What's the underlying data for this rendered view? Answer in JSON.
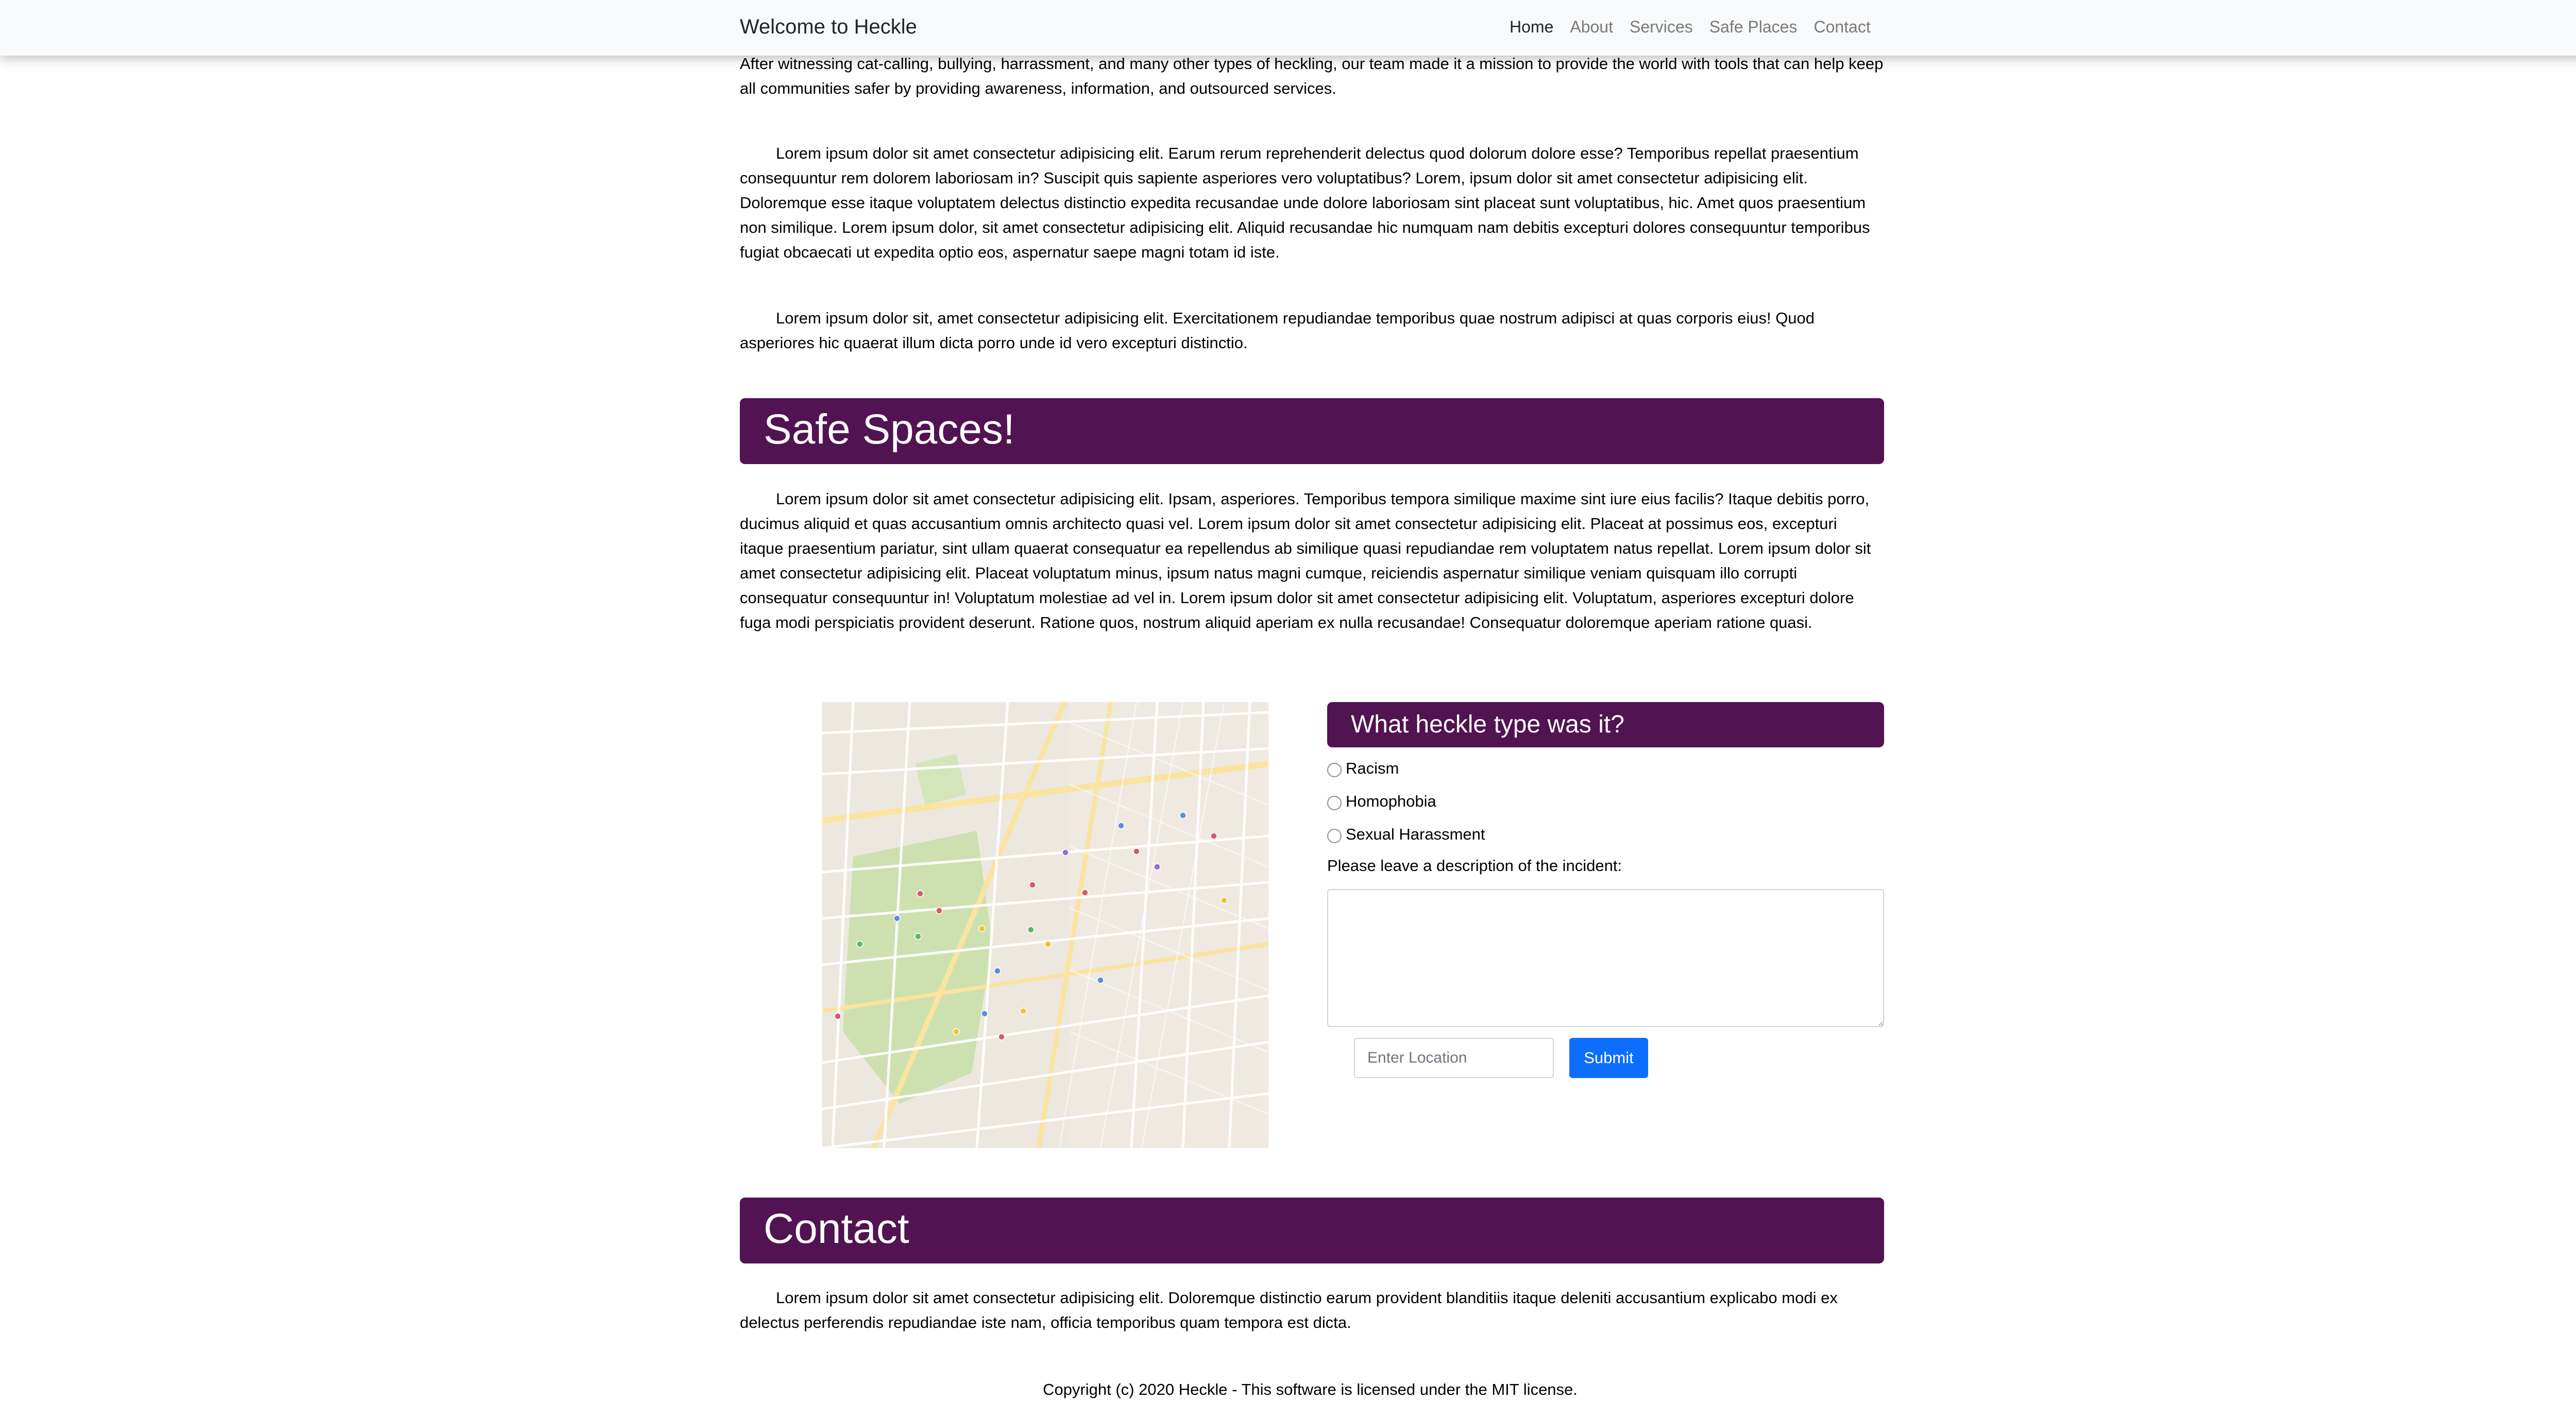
{
  "navbar": {
    "brand": "Welcome to Heckle",
    "links": [
      "Home",
      "About",
      "Services",
      "Safe Places",
      "Contact"
    ],
    "active_link": "Home"
  },
  "intro": {
    "p1": "After witnessing cat-calling, bullying, harrassment, and many other types of heckling, our team made it a mission to provide the world with tools that can help keep all communities safer by providing awareness, information, and outsourced services.",
    "p2": "Lorem ipsum dolor sit amet consectetur adipisicing elit. Earum rerum reprehenderit delectus quod dolorum dolore esse? Temporibus repellat praesentium consequuntur rem dolorem laboriosam in? Suscipit quis sapiente asperiores vero voluptatibus? Lorem, ipsum dolor sit amet consectetur adipisicing elit. Doloremque esse itaque voluptatem delectus distinctio expedita recusandae unde dolore laboriosam sint placeat sunt voluptatibus, hic. Amet quos praesentium non similique. Lorem ipsum dolor, sit amet consectetur adipisicing elit. Aliquid recusandae hic numquam nam debitis excepturi dolores consequuntur temporibus fugiat obcaecati ut expedita optio eos, aspernatur saepe magni totam id iste.",
    "p3": "Lorem ipsum dolor sit, amet consectetur adipisicing elit. Exercitationem repudiandae temporibus quae nostrum adipisci at quas corporis eius! Quod asperiores hic quaerat illum dicta porro unde id vero excepturi distinctio."
  },
  "safe_spaces": {
    "title": "Safe Spaces!",
    "paragraph": "Lorem ipsum dolor sit amet consectetur adipisicing elit. Ipsam, asperiores. Temporibus tempora similique maxime sint iure eius facilis? Itaque debitis porro, ducimus aliquid et quas accusantium omnis architecto quasi vel. Lorem ipsum dolor sit amet consectetur adipisicing elit. Placeat at possimus eos, excepturi itaque praesentium pariatur, sint ullam quaerat consequatur ea repellendus ab similique quasi repudiandae rem voluptatem natus repellat. Lorem ipsum dolor sit amet consectetur adipisicing elit. Placeat voluptatum minus, ipsum natus magni cumque, reiciendis aspernatur similique veniam quisquam illo corrupti consequatur consequuntur in! Voluptatum molestiae ad vel in. Lorem ipsum dolor sit amet consectetur adipisicing elit. Voluptatum, asperiores excepturi dolore fuga modi perspiciatis provident deserunt. Ratione quos, nostrum aliquid aperiam ex nulla recusandae! Consequatur doloremque aperiam ratione quasi."
  },
  "report_form": {
    "title": "What heckle type was it?",
    "options": [
      "Racism",
      "Homophobia",
      "Sexual Harassment"
    ],
    "description_label": "Please leave a description of the incident:",
    "description_value": "",
    "location_placeholder": "Enter Location",
    "location_value": "",
    "submit_label": "Submit"
  },
  "contact": {
    "title": "Contact",
    "paragraph": "Lorem ipsum dolor sit amet consectetur adipisicing elit. Doloremque distinctio earum provident blanditiis itaque deleniti accusantium explicabo modi ex delectus perferendis repudiandae iste nam, officia temporibus quam tempora est dicta."
  },
  "footer": {
    "text": "Copyright (c) 2020 Heckle - This software is licensed under the MIT license."
  },
  "colors": {
    "banner": "#511351",
    "primary_button": "#0d6efd",
    "navbar_bg": "#f8f9fa",
    "map_park": "#c8dfa8",
    "map_road": "#ffffff",
    "map_highway": "#fbe3a0"
  },
  "map": {
    "icon": "map-image",
    "marker_colors": [
      "#d85a6a",
      "#5b8fd9",
      "#f4c430",
      "#5fb36a",
      "#9a6ad6"
    ]
  }
}
